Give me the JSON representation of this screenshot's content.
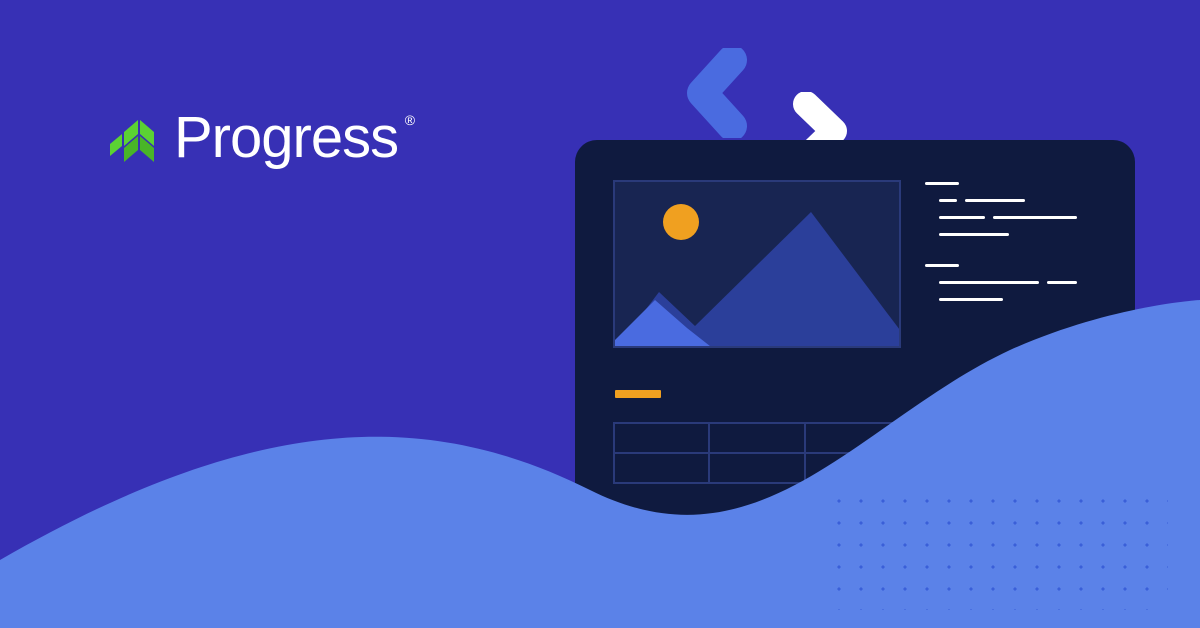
{
  "brand": {
    "name": "Progress",
    "registered_mark": "®",
    "logo_color": "#5bd233"
  },
  "colors": {
    "background": "#3730b5",
    "card": "#0f1a3f",
    "wave": "#5b82e8",
    "accent": "#f0a020",
    "chevron_blue": "#4a6be0",
    "chevron_white": "#ffffff",
    "mountain_dark": "#2b3f9a",
    "mountain_light": "#4a6be0",
    "sun": "#f0a020"
  }
}
